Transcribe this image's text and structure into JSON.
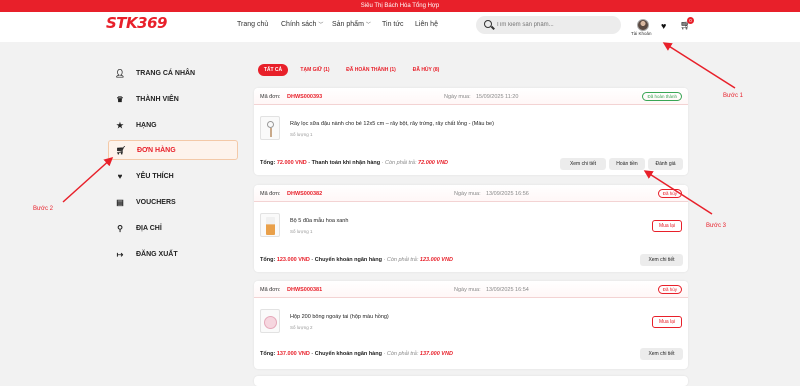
{
  "topbar": {
    "text": "Siêu Thị Bách Hóa Tổng Hợp"
  },
  "header": {
    "logo": "STK369",
    "nav": [
      "Trang chủ",
      "Chính sách",
      "Sản phẩm",
      "Tin tức",
      "Liên hệ"
    ],
    "search_placeholder": "Tìm kiếm sản phẩm...",
    "account_label": "Tài Khoản",
    "cart_count": "0"
  },
  "sidebar": [
    {
      "label": "TRANG CÁ NHÂN",
      "icon": "user-edit-icon"
    },
    {
      "label": "THÀNH VIÊN",
      "icon": "crown-icon"
    },
    {
      "label": "HẠNG",
      "icon": "star-icon"
    },
    {
      "label": "ĐƠN HÀNG",
      "icon": "cart-icon"
    },
    {
      "label": "YÊU THÍCH",
      "icon": "heart-icon"
    },
    {
      "label": "VOUCHERS",
      "icon": "voucher-icon"
    },
    {
      "label": "ĐỊA CHỈ",
      "icon": "location-icon"
    },
    {
      "label": "ĐĂNG XUẤT",
      "icon": "logout-icon"
    }
  ],
  "tabs": [
    "TẤT CẢ",
    "TẠM GIỮ (1)",
    "ĐÃ HOÀN THÀNH (1)",
    "ĐÃ HỦY (8)"
  ],
  "labels": {
    "order": "Mã đơn:",
    "date": "Ngày mua:",
    "total": "Tổng:",
    "remaining": "· Còn phải trả:",
    "view": "Xem chi tiết",
    "refund": "Hoàn tiền",
    "review": "Đánh giá",
    "rebuy": "Mua lại"
  },
  "orders": [
    {
      "id": "DHWS000393",
      "date": "15/09/2025 11:20",
      "status": "Đã hoàn thành",
      "product": "Rây lọc sữa đậu nành cho bé 12x5 cm – rây bột, rây trứng, rây chất lỏng - (Màu be)",
      "qty": "Số lượng 1",
      "total": "72.000 VND",
      "payment": "Thanh toán khi nhận hàng",
      "remaining": "72.000 VND"
    },
    {
      "id": "DHWS000382",
      "date": "13/09/2025 16:56",
      "status": "Đã hủy",
      "product": "Bộ 5 đũa mẫu hoa xanh",
      "qty": "Số lượng 1",
      "total": "123.000 VND",
      "payment": "Chuyển khoản ngân hàng",
      "remaining": "123.000 VND"
    },
    {
      "id": "DHWS000381",
      "date": "13/09/2025 16:54",
      "status": "Đã hủy",
      "product": "Hộp 200 bông ngoáy tai (hộp màu hồng)",
      "qty": "Số lượng 2",
      "total": "137.000 VND",
      "payment": "Chuyển khoản ngân hàng",
      "remaining": "137.000 VND"
    }
  ],
  "steps": [
    "Bước 1",
    "Bước 2",
    "Bước 3"
  ],
  "colors": {
    "accent": "#e8202a",
    "success": "#3aa655"
  }
}
